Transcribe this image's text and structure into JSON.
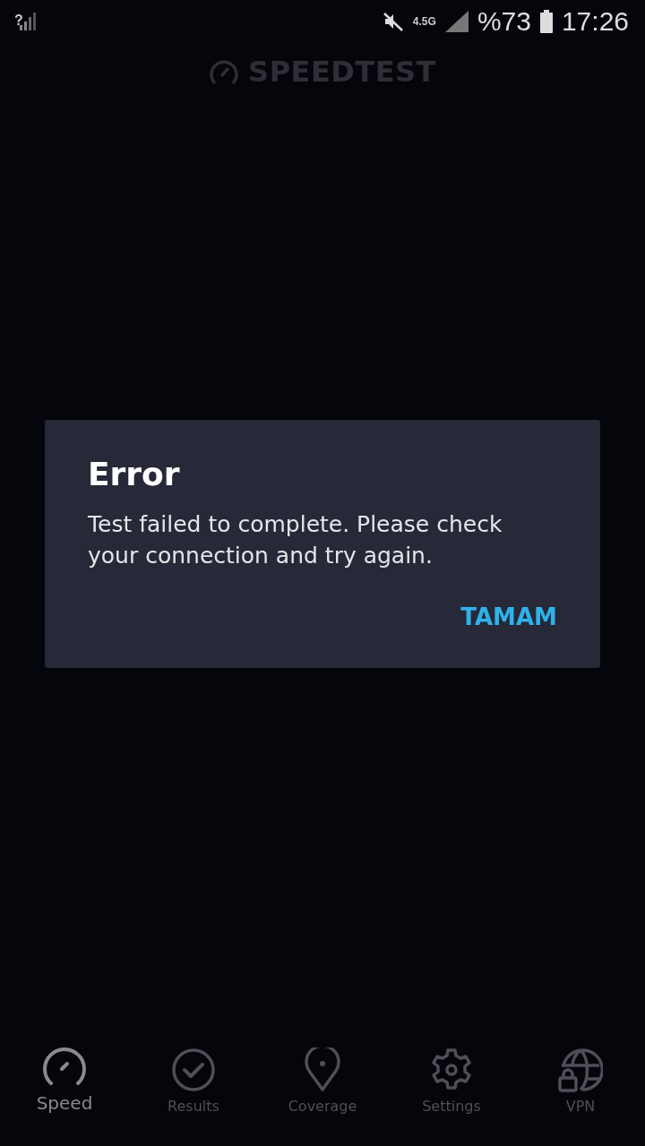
{
  "status_bar": {
    "sim_status": "?",
    "network": "4.5G",
    "battery": "%73",
    "time": "17:26"
  },
  "header": {
    "logo_text": "SPEEDTEST"
  },
  "dialog": {
    "title": "Error",
    "message": "Test failed to complete. Please check your connection and try again.",
    "button": "TAMAM"
  },
  "tabs": [
    {
      "kind": "speed",
      "label": "Speed",
      "selected": true
    },
    {
      "kind": "results",
      "label": "Results",
      "selected": false
    },
    {
      "kind": "coverage",
      "label": "Coverage",
      "selected": false
    },
    {
      "kind": "settings",
      "label": "Settings",
      "selected": false
    },
    {
      "kind": "vpn",
      "label": "VPN",
      "selected": false
    }
  ]
}
